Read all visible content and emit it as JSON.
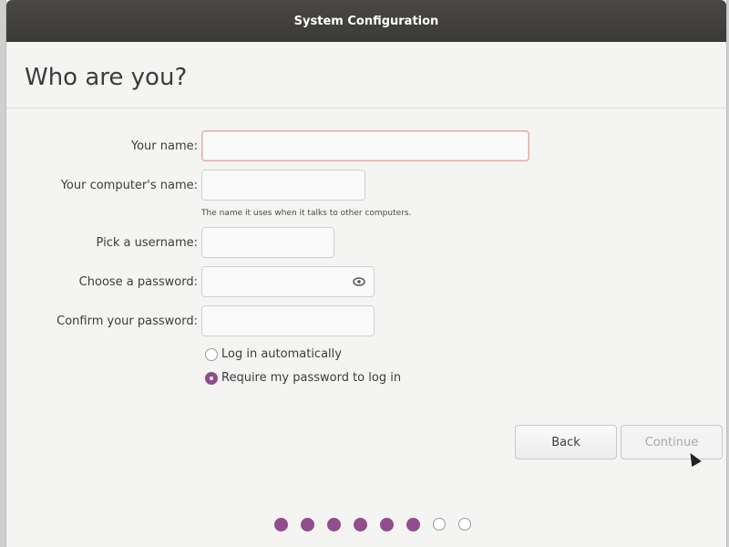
{
  "window": {
    "title": "System Configuration"
  },
  "page": {
    "heading": "Who are you?"
  },
  "form": {
    "name": {
      "label": "Your name:",
      "value": ""
    },
    "computer_name": {
      "label": "Your computer's name:",
      "value": "",
      "hint": "The name it uses when it talks to other computers."
    },
    "username": {
      "label": "Pick a username:",
      "value": ""
    },
    "password": {
      "label": "Choose a password:",
      "value": "",
      "reveal_icon": "eye-icon"
    },
    "confirm_password": {
      "label": "Confirm your password:",
      "value": ""
    },
    "login_options": [
      {
        "label": "Log in automatically",
        "selected": false
      },
      {
        "label": "Require my password to log in",
        "selected": true
      }
    ]
  },
  "buttons": {
    "back": "Back",
    "continue": "Continue",
    "continue_enabled": false
  },
  "progress": {
    "total_steps": 8,
    "completed_steps": 6
  },
  "colors": {
    "accent": "#924d8b",
    "titlebar": "#3b3a37",
    "focus_border": "#e0a8a0"
  }
}
